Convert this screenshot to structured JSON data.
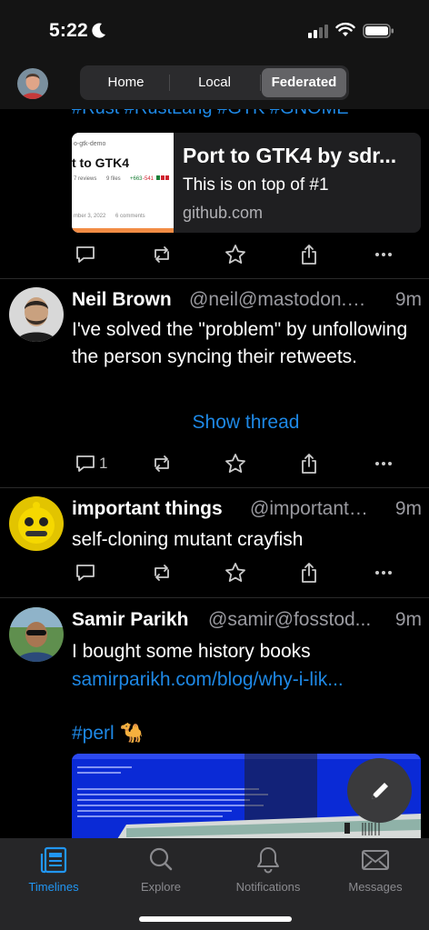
{
  "status_bar": {
    "time": "5:22"
  },
  "header": {
    "segments": [
      "Home",
      "Local",
      "Federated"
    ],
    "active_segment": "Federated"
  },
  "posts": [
    {
      "hashtags": "#Rust #RustLang #GTK #GNOME",
      "card": {
        "title": "Port to GTK4 by sdr...",
        "description": "This is on top of #1",
        "host": "github.com",
        "thumb_title": "t to GTK4",
        "thumb_top": "o-gtk-demo",
        "thumb_meta": "7 reviews",
        "thumb_files": "9 files",
        "thumb_diff_add": "+663",
        "thumb_diff_del": "-541",
        "thumb_footer": "mber 3, 2022",
        "thumb_comments": "6 comments"
      }
    },
    {
      "name": "Neil Brown",
      "handle": "@neil@mastodon.n...",
      "time": "9m",
      "text": "I've solved the \"problem\" by unfollowing the person syncing their retweets.",
      "show_thread": "Show thread",
      "replies": "1"
    },
    {
      "name": "important things",
      "handle": "@important_...",
      "time": "9m",
      "text": "self-cloning mutant crayfish"
    },
    {
      "name": "Samir Parikh",
      "handle": "@samir@fosstod...",
      "time": "9m",
      "text": "I bought some history books",
      "link": "samirparikh.com/blog/why-i-lik...",
      "hashtag": "#perl 🐪"
    }
  ],
  "tabs": [
    {
      "label": "Timelines",
      "icon": "timelines-icon"
    },
    {
      "label": "Explore",
      "icon": "search-icon"
    },
    {
      "label": "Notifications",
      "icon": "bell-icon"
    },
    {
      "label": "Messages",
      "icon": "envelope-icon"
    }
  ],
  "colors": {
    "accent": "#1e88e5",
    "tab_active": "#2196f3",
    "background": "#000000"
  }
}
